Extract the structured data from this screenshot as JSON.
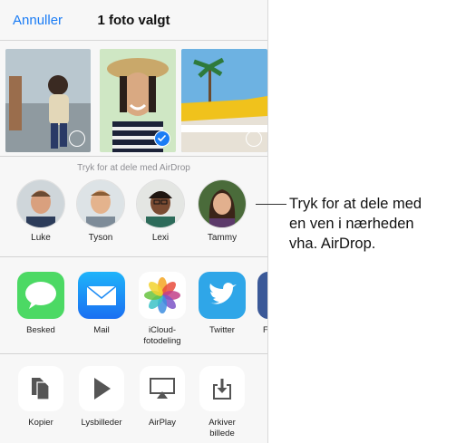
{
  "nav": {
    "cancel": "Annuller",
    "title": "1 foto valgt"
  },
  "airdrop": {
    "hint": "Tryk for at dele med AirDrop",
    "people": [
      {
        "name": "Luke"
      },
      {
        "name": "Tyson"
      },
      {
        "name": "Lexi"
      },
      {
        "name": "Tammy"
      }
    ]
  },
  "apps": [
    {
      "label": "Besked",
      "icon": "messages-icon",
      "color": "#4cd964"
    },
    {
      "label": "Mail",
      "icon": "mail-icon",
      "color": "#1d8cf5"
    },
    {
      "label": "iCloud-\nfotodeling",
      "icon": "photos-icon",
      "color": "#ffffff"
    },
    {
      "label": "Twitter",
      "icon": "twitter-icon",
      "color": "#2fa6e8"
    },
    {
      "label": "F",
      "icon": "facebook-icon",
      "color": "#3b5998"
    }
  ],
  "actions": [
    {
      "label": "Kopier",
      "icon": "copy-icon"
    },
    {
      "label": "Lysbilleder",
      "icon": "play-icon"
    },
    {
      "label": "AirPlay",
      "icon": "airplay-icon"
    },
    {
      "label": "Arkiver\nbillede",
      "icon": "save-icon"
    }
  ],
  "callout": {
    "line1": "Tryk for at dele med",
    "line2": "en ven i nærheden",
    "line3": "vha. AirDrop."
  }
}
